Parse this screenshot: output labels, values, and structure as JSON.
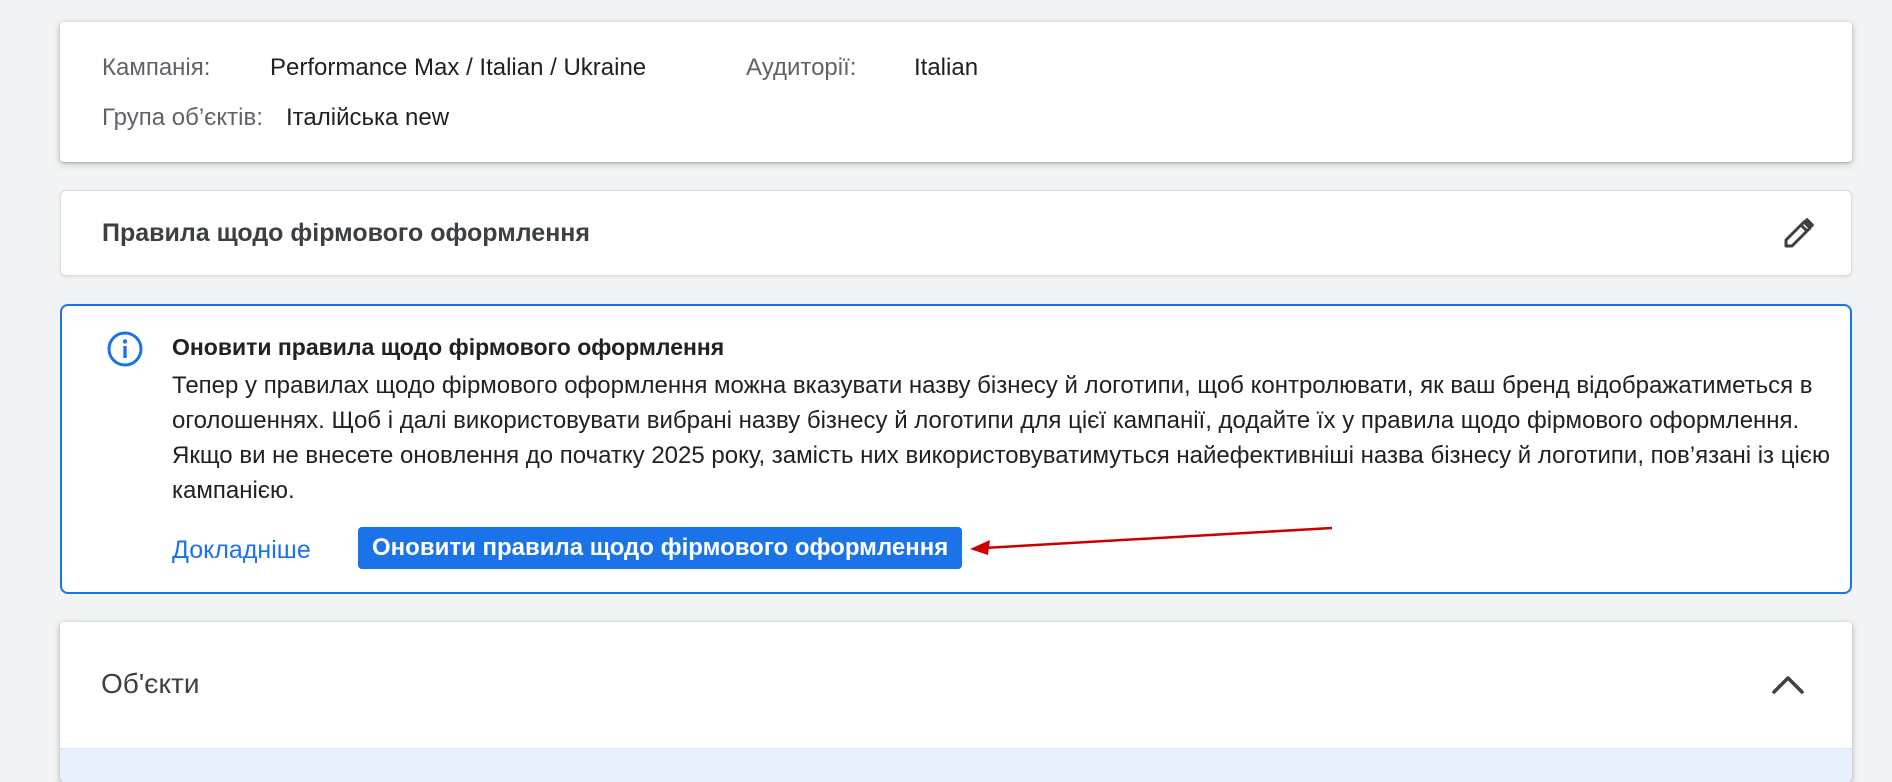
{
  "summary": {
    "campaign_label": "Кампанія:",
    "campaign_value": "Performance Max / Italian / Ukraine",
    "audience_label": "Аудиторії:",
    "audience_value": "Italian",
    "asset_group_label": "Група об’єктів:",
    "asset_group_value": "Італійська new"
  },
  "guidelines": {
    "title": "Правила щодо фірмового оформлення",
    "edit_icon": "pencil-icon"
  },
  "banner": {
    "icon": "info-icon",
    "title": "Оновити правила щодо фірмового оформлення",
    "body": "Тепер у правилах щодо фірмового оформлення можна вказувати назву бізнесу й логотипи, щоб контролювати, як ваш бренд відображатиметься в оголошеннях. Щоб і далі використовувати вибрані назву бізнесу й логотипи для цієї кампанії, додайте їх у правила щодо фірмового оформлення. Якщо ви не внесете оновлення до початку 2025 року, замість них використовуватимуться найефективніші назва бізнесу й логотипи, пов’язані із цією кампанією.",
    "learn_more_label": "Докладніше",
    "update_button_label": "Оновити правила щодо фірмового оформлення"
  },
  "assets": {
    "title": "Об'єкти",
    "collapse_icon": "chevron-up-icon"
  },
  "colors": {
    "accent": "#1a73e8",
    "annotation_arrow": "#cc0000",
    "page_background": "#f1f3f4"
  }
}
